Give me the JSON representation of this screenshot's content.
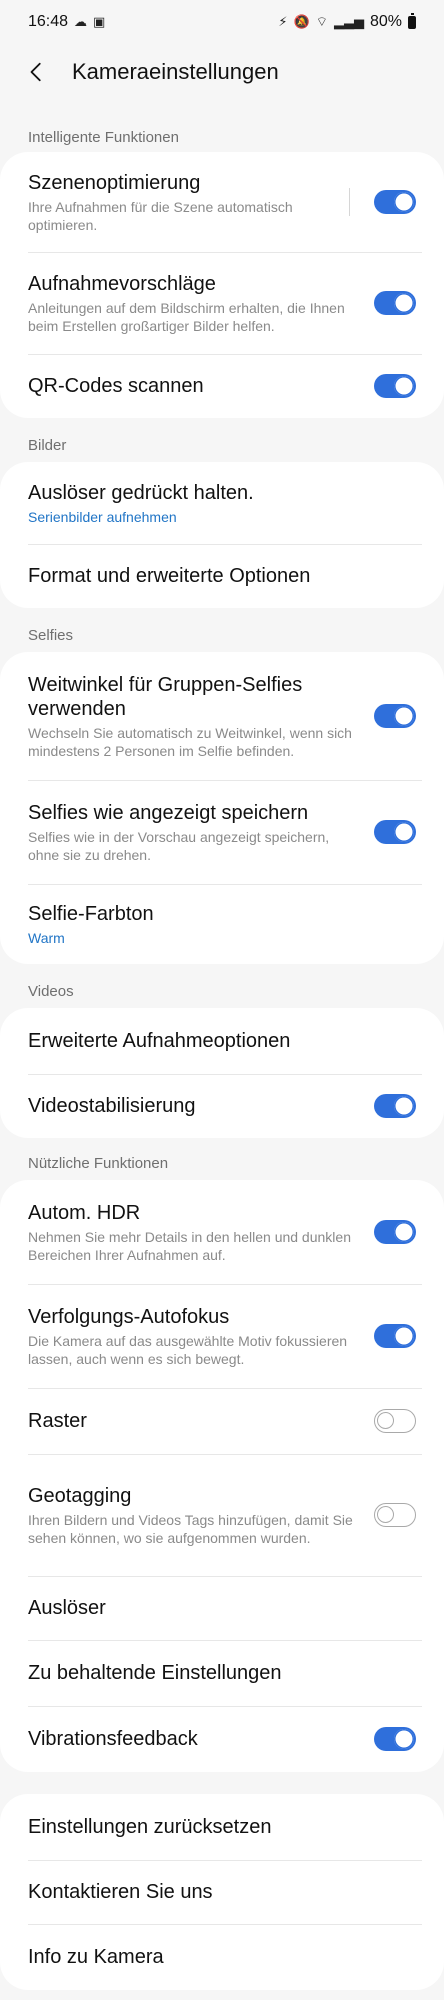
{
  "status": {
    "time": "16:48",
    "battery": "80%"
  },
  "header": {
    "title": "Kameraeinstellungen"
  },
  "sections": {
    "smart": {
      "label": "Intelligente Funktionen",
      "scene_title": "Szenenoptimierung",
      "scene_sub": "Ihre Aufnahmen für die Szene automatisch optimieren.",
      "suggest_title": "Aufnahmevorschläge",
      "suggest_sub": "Anleitungen auf dem Bildschirm erhalten, die Ihnen beim Erstellen großartiger Bilder helfen.",
      "qr_title": "QR-Codes scannen"
    },
    "pictures": {
      "label": "Bilder",
      "shutter_hold_title": "Auslöser gedrückt halten.",
      "shutter_hold_value": "Serienbilder aufnehmen",
      "format_title": "Format und erweiterte Optionen"
    },
    "selfies": {
      "label": "Selfies",
      "wide_title": "Weitwinkel für Gruppen-Selfies verwenden",
      "wide_sub": "Wechseln Sie automatisch zu Weitwinkel, wenn sich mindestens 2 Personen im Selfie befinden.",
      "save_title": "Selfies wie angezeigt speichern",
      "save_sub": "Selfies wie in der Vorschau angezeigt speichern, ohne sie zu drehen.",
      "tone_title": "Selfie-Farbton",
      "tone_value": "Warm"
    },
    "videos": {
      "label": "Videos",
      "advanced_title": "Erweiterte Aufnahmeoptionen",
      "stab_title": "Videostabilisierung"
    },
    "useful": {
      "label": "Nützliche Funktionen",
      "hdr_title": "Autom. HDR",
      "hdr_sub": "Nehmen Sie mehr Details in den hellen und dunklen Bereichen Ihrer Aufnahmen auf.",
      "af_title": "Verfolgungs-Autofokus",
      "af_sub": "Die Kamera auf das ausgewählte Motiv fokussieren lassen, auch wenn es sich bewegt.",
      "grid_title": "Raster",
      "geo_title": "Geotagging",
      "geo_sub": "Ihren Bildern und Videos Tags hinzufügen, damit Sie sehen können, wo sie aufgenommen wurden.",
      "shutter_title": "Auslöser",
      "keep_title": "Zu behaltende Einstellungen",
      "vibration_title": "Vibrationsfeedback"
    },
    "misc": {
      "reset_title": "Einstellungen zurücksetzen",
      "contact_title": "Kontaktieren Sie uns",
      "info_title": "Info zu Kamera"
    }
  },
  "toggles": {
    "scene": true,
    "suggest": true,
    "qr": true,
    "wide": true,
    "save": true,
    "stab": true,
    "hdr": true,
    "af": true,
    "grid": false,
    "geo": false,
    "vibration": true
  },
  "colors": {
    "accent": "#2f6fdb",
    "link": "#2175c6",
    "background": "#f6f6f6",
    "card": "#ffffff"
  }
}
